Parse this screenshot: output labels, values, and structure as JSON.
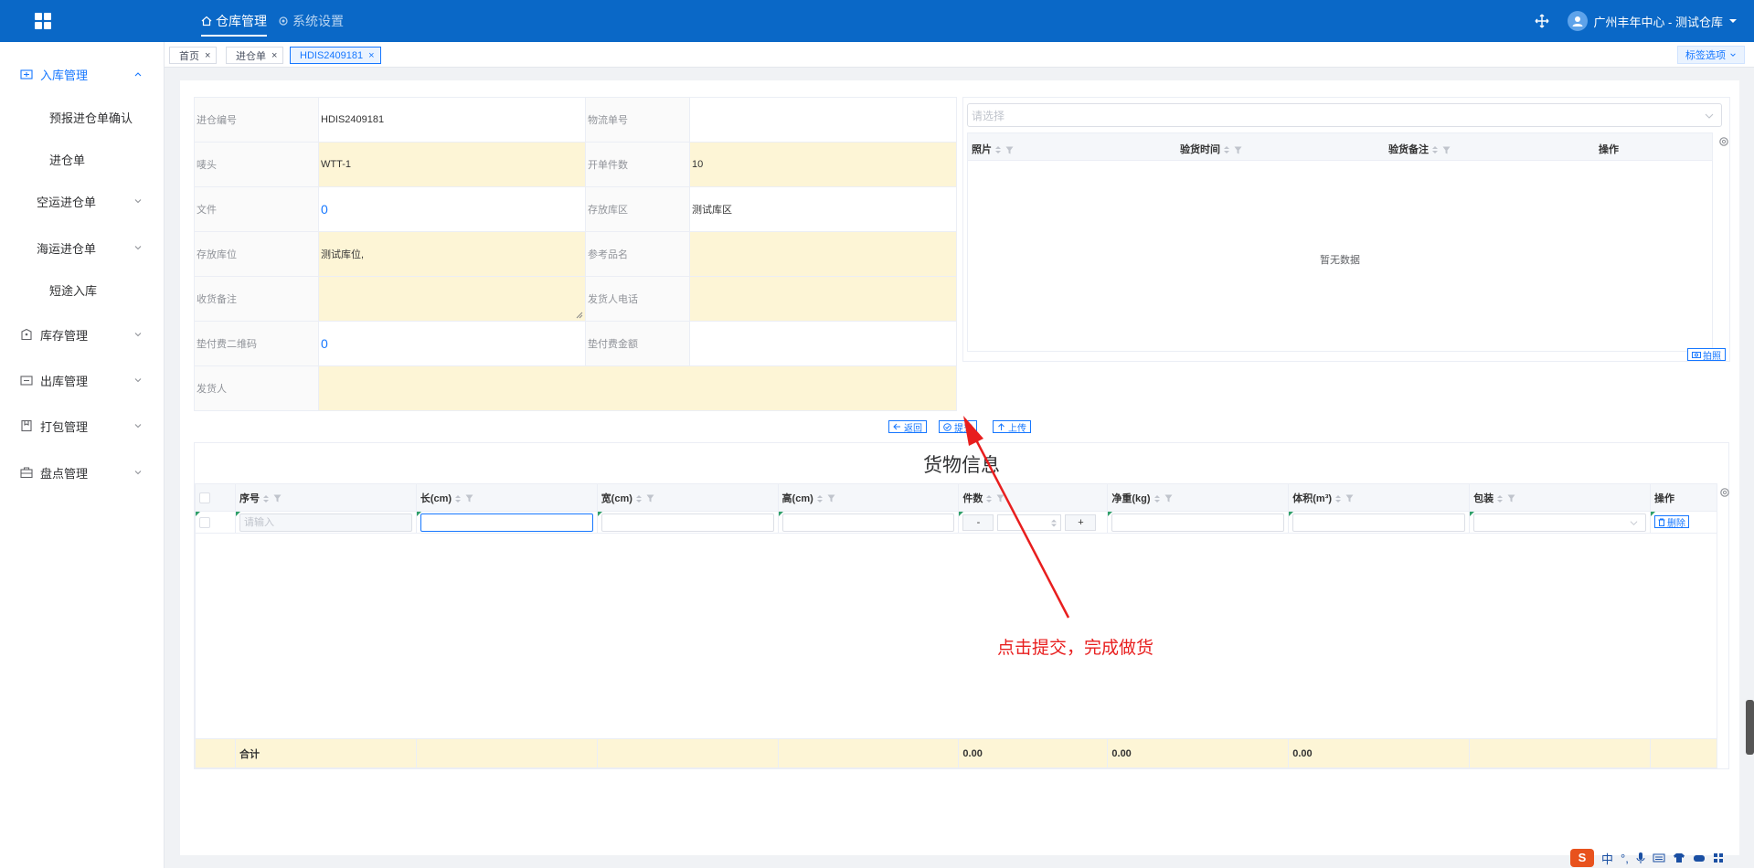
{
  "topbar": {
    "nav": [
      {
        "label": "仓库管理"
      },
      {
        "label": "系统设置"
      }
    ],
    "user": "广州丰年中心 - 测试仓库"
  },
  "sidebar": {
    "inbound": "入库管理",
    "sub": [
      "预报进仓单确认",
      "进仓单",
      "空运进仓单",
      "海运进仓单",
      "短途入库"
    ],
    "groups": [
      "库存管理",
      "出库管理",
      "打包管理",
      "盘点管理"
    ]
  },
  "tabs": [
    {
      "label": "首页"
    },
    {
      "label": "进仓单"
    },
    {
      "label": "HDIS2409181"
    }
  ],
  "tag_options": "标签选项",
  "form": {
    "rows": [
      {
        "l1": "进仓编号",
        "v1": "HDIS2409181",
        "l2": "物流单号",
        "v2": ""
      },
      {
        "l1": "唛头",
        "v1": "WTT-1",
        "l2": "开单件数",
        "v2": "10"
      },
      {
        "l1": "文件",
        "v1": "0",
        "l2": "存放库区",
        "v2": "测试库区"
      },
      {
        "l1": "存放库位",
        "v1": "测试库位,",
        "l2": "参考品名",
        "v2": ""
      },
      {
        "l1": "收货备注",
        "v1": "",
        "l2": "发货人电话",
        "v2": ""
      },
      {
        "l1": "垫付费二维码",
        "v1": "0",
        "l2": "垫付费金额",
        "v2": ""
      },
      {
        "l1": "发货人",
        "v1": ""
      }
    ]
  },
  "right_panel": {
    "select_placeholder": "请选择",
    "columns": [
      "照片",
      "验货时间",
      "验货备注",
      "操作"
    ],
    "empty": "暂无数据",
    "photo_btn": "拍照"
  },
  "actions": {
    "back": "返回",
    "submit": "提交",
    "upload": "上传"
  },
  "goods": {
    "title": "货物信息",
    "columns": [
      "序号",
      "长(cm)",
      "宽(cm)",
      "高(cm)",
      "件数",
      "净重(kg)",
      "体积(m³)",
      "包装",
      "操作"
    ],
    "seq_placeholder": "请输入",
    "qty_minus": "-",
    "qty_plus": "+",
    "delete": "删除",
    "sum_label": "合计",
    "sum_qty": "0.00",
    "sum_weight": "0.00",
    "sum_volume": "0.00"
  },
  "annotation": "点击提交，完成做货",
  "ime": {
    "s": "S",
    "items": [
      "中",
      "°,"
    ]
  }
}
